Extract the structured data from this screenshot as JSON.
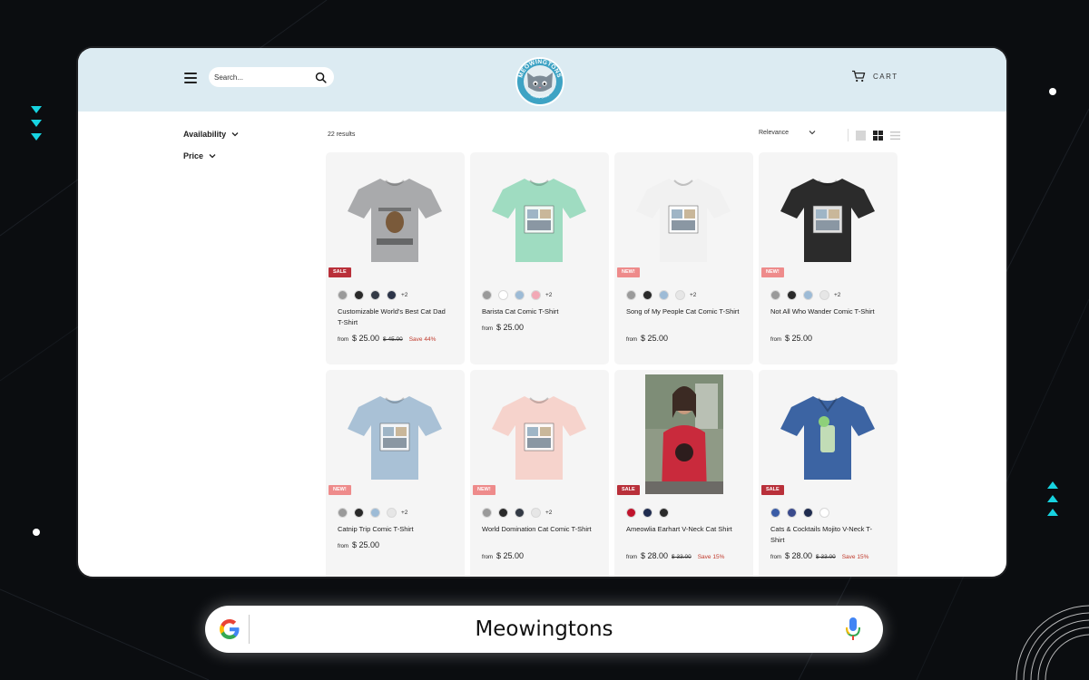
{
  "header": {
    "search_placeholder": "Search...",
    "cart_label": "CART",
    "logo_text": "MEOWINGTONS",
    "logo_sub": "MEOW CLUB"
  },
  "filters": [
    {
      "label": "Availability"
    },
    {
      "label": "Price"
    }
  ],
  "toolbar": {
    "results": "22 results",
    "sort_value": "Relevance"
  },
  "products": [
    {
      "title": "Customizable World's Best Cat Dad T-Shirt",
      "badge": "SALE",
      "from": "from",
      "price": "$ 25.00",
      "compare": "$ 45.00",
      "save": "Save 44%",
      "swatches": [
        "#9a9a9a",
        "#2a2a2a",
        "#333a45",
        "#2c3448"
      ],
      "more": "+2",
      "shirt": "#a9aaac",
      "art": "Cat Dad T-Shirt graphic"
    },
    {
      "title": "Barista Cat Comic T-Shirt",
      "badge": "",
      "from": "from",
      "price": "$ 25.00",
      "compare": "",
      "save": "",
      "swatches": [
        "#9a9a9a",
        "#ffffff",
        "#9dbbd6",
        "#f2a9b6"
      ],
      "more": "+2",
      "shirt": "#9fdcc1",
      "art": "Comic art"
    },
    {
      "title": "Song of My People Cat Comic T-Shirt",
      "badge": "NEW!",
      "from": "from",
      "price": "$ 25.00",
      "compare": "",
      "save": "",
      "swatches": [
        "#9a9a9a",
        "#2a2a2a",
        "#9dbbd6",
        "#e6e6e6"
      ],
      "more": "+2",
      "shirt": "#f1f1f1",
      "art": "Comic art"
    },
    {
      "title": "Not All Who Wander Comic T-Shirt",
      "badge": "NEW!",
      "from": "from",
      "price": "$ 25.00",
      "compare": "",
      "save": "",
      "swatches": [
        "#9a9a9a",
        "#2a2a2a",
        "#9dbbd6",
        "#e6e6e6"
      ],
      "more": "+2",
      "shirt": "#2b2b2b",
      "art": "Comic art"
    },
    {
      "title": "Catnip Trip Comic T-Shirt",
      "badge": "NEW!",
      "from": "from",
      "price": "$ 25.00",
      "compare": "",
      "save": "",
      "swatches": [
        "#9a9a9a",
        "#2a2a2a",
        "#9dbbd6",
        "#e6e6e6"
      ],
      "more": "+2",
      "shirt": "#a9c1d6",
      "art": "Comic art"
    },
    {
      "title": "World Domination Cat Comic T-Shirt",
      "badge": "NEW!",
      "from": "from",
      "price": "$ 25.00",
      "compare": "",
      "save": "",
      "swatches": [
        "#9a9a9a",
        "#2a2a2a",
        "#333a45",
        "#e6e6e6"
      ],
      "more": "+2",
      "shirt": "#f6d3cc",
      "art": "Comic art"
    },
    {
      "title": "Ameowlia Earhart V-Neck Cat Shirt",
      "badge": "SALE",
      "from": "from",
      "price": "$ 28.00",
      "compare": "$ 33.00",
      "save": "Save 15%",
      "swatches": [
        "#c0142c",
        "#1f2c4f",
        "#2a2a2a"
      ],
      "more": "",
      "shirt": "#c92a3c",
      "art": "Model photo"
    },
    {
      "title": "Cats & Cocktails Mojito V-Neck T-Shirt",
      "badge": "SALE",
      "from": "from",
      "price": "$ 28.00",
      "compare": "$ 33.00",
      "save": "Save 15%",
      "swatches": [
        "#3a5ca6",
        "#3a4a8c",
        "#1f2c4f",
        "#ffffff"
      ],
      "more": "",
      "shirt": "#3c64a3",
      "art": "Mojito art"
    }
  ],
  "google": {
    "query": "Meowingtons"
  },
  "colors": {
    "header_bg": "#dcebf2",
    "sale_badge": "#b9303a",
    "new_badge": "#ee8b8b",
    "accent_cyan": "#17d3e0"
  }
}
